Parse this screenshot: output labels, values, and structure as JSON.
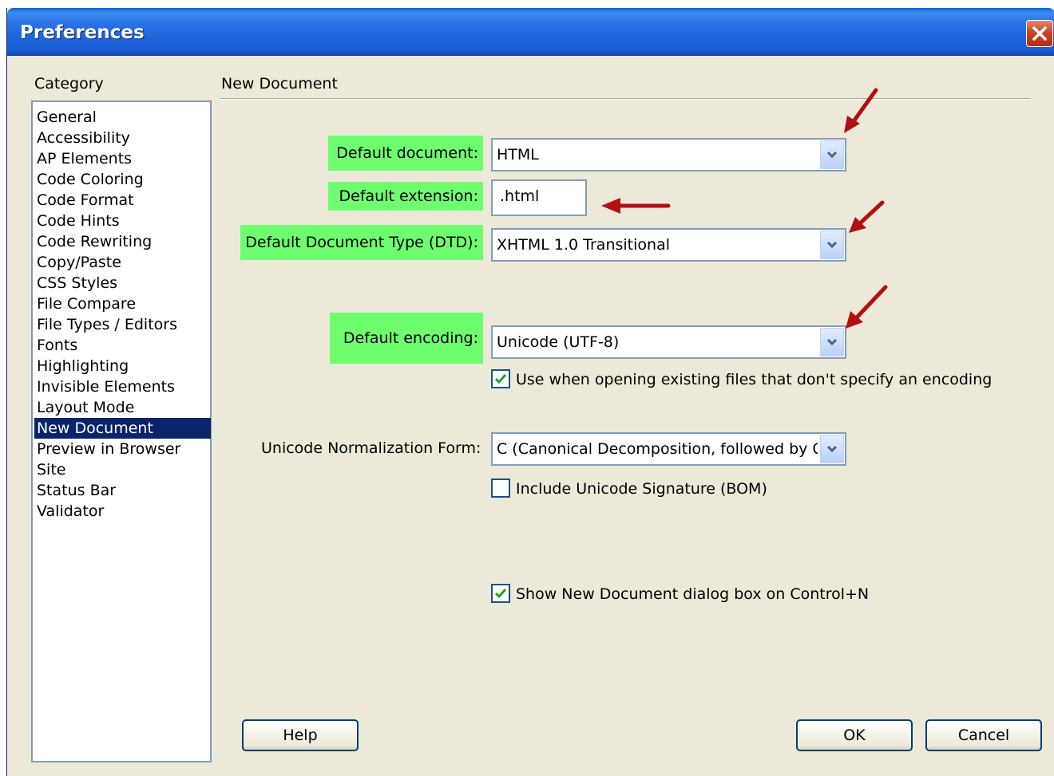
{
  "window": {
    "title": "Preferences"
  },
  "category": {
    "heading": "Category",
    "items": [
      "General",
      "Accessibility",
      "AP Elements",
      "Code Coloring",
      "Code Format",
      "Code Hints",
      "Code Rewriting",
      "Copy/Paste",
      "CSS Styles",
      "File Compare",
      "File Types / Editors",
      "Fonts",
      "Highlighting",
      "Invisible Elements",
      "Layout Mode",
      "New Document",
      "Preview in Browser",
      "Site",
      "Status Bar",
      "Validator"
    ],
    "selected": "New Document"
  },
  "section": {
    "title": "New Document"
  },
  "form": {
    "default_document": {
      "label": "Default document:",
      "value": "HTML"
    },
    "default_extension": {
      "label": "Default extension:",
      "value": ".html"
    },
    "default_dtd": {
      "label": "Default Document Type (DTD):",
      "value": "XHTML 1.0 Transitional"
    },
    "default_encoding": {
      "label": "Default encoding:",
      "value": "Unicode (UTF-8)"
    },
    "use_when_opening": {
      "label": "Use when opening existing files that don't specify an encoding",
      "checked": true
    },
    "normalization": {
      "label": "Unicode Normalization Form:",
      "value": "C (Canonical Decomposition, followed by Canonical Composition)"
    },
    "include_bom": {
      "label": "Include Unicode Signature (BOM)",
      "checked": false
    },
    "show_new_doc_dialog": {
      "label": "Show New Document dialog box on Control+N",
      "checked": true
    }
  },
  "buttons": {
    "help": "Help",
    "ok": "OK",
    "cancel": "Cancel"
  },
  "colors": {
    "highlight": "#6dfd6f",
    "arrow": "#b01010",
    "selection": "#0a246a"
  },
  "icons": {
    "close": "close-icon",
    "dropdown": "chevron-down-icon",
    "check": "checkmark-icon",
    "annotation": "red-arrow-icon"
  }
}
